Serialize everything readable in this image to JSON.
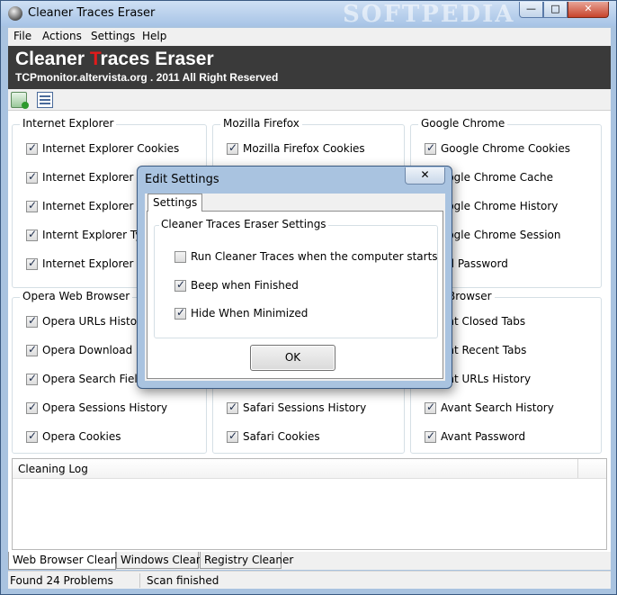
{
  "window": {
    "title": "Cleaner Traces Eraser",
    "watermark": "SOFTPEDIA"
  },
  "window_controls": {
    "minimize": "—",
    "maximize": "□",
    "close": "✕"
  },
  "menu": [
    "File",
    "Actions",
    "Settings",
    "Help"
  ],
  "banner": {
    "title_prefix": "Cleaner ",
    "title_red": "T",
    "title_suffix": "races Eraser",
    "subtitle": "TCPmonitor.altervista.org . 2011 All Right Reserved"
  },
  "toolbar": {
    "icons": [
      "run-clean-icon",
      "settings-list-icon"
    ]
  },
  "groups": [
    {
      "title": "Internet Explorer",
      "items": [
        {
          "label": "Internet Explorer Cookies",
          "checked": true
        },
        {
          "label": "Internet Explorer Cac",
          "checked": true
        },
        {
          "label": "Internet Explorer Hist",
          "checked": true
        },
        {
          "label": "Internt Explorer Type",
          "checked": true
        },
        {
          "label": "Internet Explorer Dow",
          "checked": true
        }
      ]
    },
    {
      "title": "Mozilla Firefox",
      "items": [
        {
          "label": "Mozilla Firefox Cookies",
          "checked": true
        }
      ]
    },
    {
      "title": "Google Chrome",
      "items": [
        {
          "label": "Google Chrome Cookies",
          "checked": true
        },
        {
          "label": "oogle Chrome Cache",
          "checked": true
        },
        {
          "label": "oogle Chrome History",
          "checked": true
        },
        {
          "label": "oogle Chrome Session",
          "checked": true
        },
        {
          "label": "ed Password",
          "checked": true
        }
      ]
    },
    {
      "title": "Opera Web Browser",
      "items": [
        {
          "label": "Opera URLs History",
          "checked": true
        },
        {
          "label": "Opera Download Histo",
          "checked": true
        },
        {
          "label": "Opera Search Field His",
          "checked": true
        },
        {
          "label": "Opera Sessions History",
          "checked": true
        },
        {
          "label": "Opera Cookies",
          "checked": true
        }
      ]
    },
    {
      "title": "",
      "items": [
        {
          "label": "Safari Sessions History",
          "checked": true
        },
        {
          "label": "Safari Cookies",
          "checked": true
        }
      ]
    },
    {
      "title": "Web Browser",
      "items": [
        {
          "label": "ant Closed Tabs",
          "checked": true
        },
        {
          "label": "ant Recent Tabs",
          "checked": true
        },
        {
          "label": "ant URLs History",
          "checked": true
        },
        {
          "label": "Avant Search History",
          "checked": true
        },
        {
          "label": "Avant Password",
          "checked": true
        }
      ]
    }
  ],
  "log": {
    "title": "Cleaning Log"
  },
  "bottom_tabs": [
    "Web Browser Cleaner",
    "Windows Cleaner",
    "Registry Cleaner"
  ],
  "status": {
    "found": "Found  24 Problems",
    "state": "Scan finished"
  },
  "dialog": {
    "title": "Edit Settings",
    "close": "✕",
    "tab": "Settings",
    "group_title": "Cleaner Traces Eraser Settings",
    "options": [
      {
        "label": "Run Cleaner Traces when the computer starts",
        "checked": false
      },
      {
        "label": "Beep when Finished",
        "checked": true
      },
      {
        "label": "Hide When Minimized",
        "checked": true
      }
    ],
    "ok": "OK"
  }
}
